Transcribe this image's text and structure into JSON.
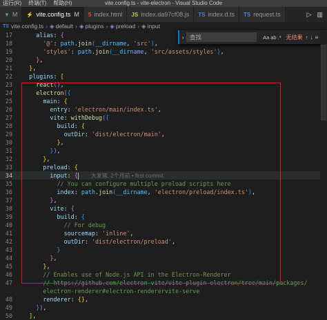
{
  "titlebar": {
    "menu": [
      "运行(R)",
      "终端(T)",
      "帮助(H)"
    ],
    "title": "vite.config.ts - vite-electron - Visual Studio Code"
  },
  "tabs": [
    {
      "icon": "vue",
      "label": "M",
      "modified": false,
      "active": false
    },
    {
      "icon": "vite",
      "label": "vite.config.ts",
      "mod": "M",
      "active": true
    },
    {
      "icon": "html",
      "label": "index.html",
      "active": false
    },
    {
      "icon": "js",
      "label": "index.da97cf08.js",
      "active": false
    },
    {
      "icon": "ts",
      "label": "index.d.ts",
      "active": false
    },
    {
      "icon": "ts",
      "label": "request.ts",
      "active": false
    }
  ],
  "breadcrumb": [
    "vite.config.ts",
    "default",
    "plugins",
    "preload",
    "input"
  ],
  "find": {
    "placeholder": "查找",
    "opt_case": "Aa",
    "opt_word": "ab",
    "opt_regex": ".*",
    "result": "无结果"
  },
  "code_lines": [
    {
      "n": "17",
      "tokens": [
        [
          "w",
          "      "
        ],
        [
          "p",
          "alias"
        ],
        [
          "w",
          ": "
        ],
        [
          "b2",
          "{"
        ]
      ]
    },
    {
      "n": "18",
      "tokens": [
        [
          "w",
          "        "
        ],
        [
          "s",
          "'@'"
        ],
        [
          "w",
          ": "
        ],
        [
          "v",
          "path"
        ],
        [
          "w",
          "."
        ],
        [
          "f",
          "join"
        ],
        [
          "b3",
          "("
        ],
        [
          "v",
          "__dirname"
        ],
        [
          "w",
          ", "
        ],
        [
          "s",
          "'src'"
        ],
        [
          "b3",
          ")"
        ],
        [
          "w",
          ","
        ]
      ]
    },
    {
      "n": "19",
      "tokens": [
        [
          "w",
          "        "
        ],
        [
          "s",
          "'styles'"
        ],
        [
          "w",
          ": "
        ],
        [
          "v",
          "path"
        ],
        [
          "w",
          "."
        ],
        [
          "f",
          "join"
        ],
        [
          "b3",
          "("
        ],
        [
          "v",
          "__dirname"
        ],
        [
          "w",
          ", "
        ],
        [
          "s",
          "'src/assets/styles'"
        ],
        [
          "b3",
          ")"
        ],
        [
          "w",
          ","
        ]
      ]
    },
    {
      "n": "20",
      "tokens": [
        [
          "w",
          "      "
        ],
        [
          "b2",
          "}"
        ],
        [
          "w",
          ","
        ]
      ]
    },
    {
      "n": "21",
      "tokens": [
        [
          "w",
          "    "
        ],
        [
          "b1",
          "}"
        ],
        [
          "w",
          ","
        ]
      ]
    },
    {
      "n": "22",
      "tokens": [
        [
          "w",
          "    "
        ],
        [
          "p",
          "plugins"
        ],
        [
          "w",
          ": "
        ],
        [
          "b1",
          "["
        ]
      ]
    },
    {
      "n": "23",
      "tokens": [
        [
          "w",
          "      "
        ],
        [
          "f",
          "react"
        ],
        [
          "b2",
          "()"
        ],
        [
          "w",
          ","
        ]
      ]
    },
    {
      "n": "24",
      "tokens": [
        [
          "w",
          "      "
        ],
        [
          "f",
          "electron"
        ],
        [
          "b2",
          "("
        ],
        [
          "b3",
          "{"
        ]
      ]
    },
    {
      "n": "25",
      "tokens": [
        [
          "w",
          "        "
        ],
        [
          "p",
          "main"
        ],
        [
          "w",
          ": "
        ],
        [
          "b1",
          "{"
        ]
      ]
    },
    {
      "n": "26",
      "tokens": [
        [
          "w",
          "          "
        ],
        [
          "p",
          "entry"
        ],
        [
          "w",
          ": "
        ],
        [
          "s",
          "'electron/main/index.ts'"
        ],
        [
          "w",
          ","
        ]
      ]
    },
    {
      "n": "27",
      "tokens": [
        [
          "w",
          "          "
        ],
        [
          "p",
          "vite"
        ],
        [
          "w",
          ": "
        ],
        [
          "f",
          "withDebug"
        ],
        [
          "b2",
          "("
        ],
        [
          "b3",
          "{"
        ]
      ]
    },
    {
      "n": "28",
      "tokens": [
        [
          "w",
          "            "
        ],
        [
          "p",
          "build"
        ],
        [
          "w",
          ": "
        ],
        [
          "b1",
          "{"
        ]
      ]
    },
    {
      "n": "29",
      "tokens": [
        [
          "w",
          "              "
        ],
        [
          "p",
          "outDir"
        ],
        [
          "w",
          ": "
        ],
        [
          "s",
          "'dist/electron/main'"
        ],
        [
          "w",
          ","
        ]
      ]
    },
    {
      "n": "30",
      "tokens": [
        [
          "w",
          "            "
        ],
        [
          "b1",
          "}"
        ],
        [
          "w",
          ","
        ]
      ]
    },
    {
      "n": "31",
      "tokens": [
        [
          "w",
          "          "
        ],
        [
          "b3",
          "}"
        ],
        [
          "b2",
          ")"
        ],
        [
          "w",
          ","
        ]
      ]
    },
    {
      "n": "32",
      "tokens": [
        [
          "w",
          "        "
        ],
        [
          "b1",
          "}"
        ],
        [
          "w",
          ","
        ]
      ]
    },
    {
      "n": "33",
      "tokens": [
        [
          "w",
          "        "
        ],
        [
          "p",
          "preload"
        ],
        [
          "w",
          ": "
        ],
        [
          "b1",
          "{"
        ]
      ]
    },
    {
      "n": "34",
      "tokens": [
        [
          "w",
          "          "
        ],
        [
          "p",
          "input"
        ],
        [
          "w",
          ": "
        ],
        [
          "b2",
          "{"
        ],
        [
          "cursor",
          ""
        ]
      ],
      "blame": "大发猪, 2个月前 • first commit",
      "current": true
    },
    {
      "n": "35",
      "tokens": [
        [
          "w",
          "            "
        ],
        [
          "c",
          "// You can configure multiple preload scripts here"
        ]
      ]
    },
    {
      "n": "36",
      "tokens": [
        [
          "w",
          "            "
        ],
        [
          "p",
          "index"
        ],
        [
          "w",
          ": "
        ],
        [
          "v",
          "path"
        ],
        [
          "w",
          "."
        ],
        [
          "f",
          "join"
        ],
        [
          "b3",
          "("
        ],
        [
          "v",
          "__dirname"
        ],
        [
          "w",
          ", "
        ],
        [
          "s",
          "'electron/preload/index.ts'"
        ],
        [
          "b3",
          ")"
        ],
        [
          "w",
          ","
        ]
      ]
    },
    {
      "n": "37",
      "tokens": [
        [
          "w",
          "          "
        ],
        [
          "b2",
          "}"
        ],
        [
          "w",
          ","
        ]
      ]
    },
    {
      "n": "38",
      "tokens": [
        [
          "w",
          "          "
        ],
        [
          "p",
          "vite"
        ],
        [
          "w",
          ": "
        ],
        [
          "b2",
          "{"
        ]
      ]
    },
    {
      "n": "39",
      "tokens": [
        [
          "w",
          "            "
        ],
        [
          "p",
          "build"
        ],
        [
          "w",
          ": "
        ],
        [
          "b3",
          "{"
        ]
      ]
    },
    {
      "n": "40",
      "tokens": [
        [
          "w",
          "              "
        ],
        [
          "c",
          "// For debug"
        ]
      ]
    },
    {
      "n": "41",
      "tokens": [
        [
          "w",
          "              "
        ],
        [
          "p",
          "sourcemap"
        ],
        [
          "w",
          ": "
        ],
        [
          "s",
          "'inline'"
        ],
        [
          "w",
          ","
        ]
      ]
    },
    {
      "n": "42",
      "tokens": [
        [
          "w",
          "              "
        ],
        [
          "p",
          "outDir"
        ],
        [
          "w",
          ": "
        ],
        [
          "s",
          "'dist/electron/preload'"
        ],
        [
          "w",
          ","
        ]
      ]
    },
    {
      "n": "43",
      "tokens": [
        [
          "w",
          "            "
        ],
        [
          "b3",
          "}"
        ]
      ]
    },
    {
      "n": "44",
      "tokens": [
        [
          "w",
          "          "
        ],
        [
          "b2",
          "}"
        ],
        [
          "w",
          ","
        ]
      ]
    },
    {
      "n": "45",
      "tokens": [
        [
          "w",
          "        "
        ],
        [
          "b1",
          "}"
        ],
        [
          "w",
          ","
        ]
      ]
    },
    {
      "n": "46",
      "tokens": [
        [
          "w",
          "        "
        ],
        [
          "c",
          "// Enables use of Node.js API in the Electron-Renderer"
        ]
      ]
    },
    {
      "n": "47",
      "tokens": [
        [
          "w",
          "        "
        ],
        [
          "c",
          "// https://github.com/electron-vite/vite-plugin-electron/tree/main/packages/"
        ]
      ]
    },
    {
      "n": "",
      "tokens": [
        [
          "w",
          "        "
        ],
        [
          "c",
          "electron-renderer#electron-renderervite-serve"
        ]
      ]
    },
    {
      "n": "48",
      "tokens": [
        [
          "w",
          "        "
        ],
        [
          "p",
          "renderer"
        ],
        [
          "w",
          ": "
        ],
        [
          "b1",
          "{}"
        ],
        [
          "w",
          ","
        ]
      ]
    },
    {
      "n": "49",
      "tokens": [
        [
          "w",
          "      "
        ],
        [
          "b3",
          "}"
        ],
        [
          "b2",
          ")"
        ],
        [
          "w",
          ","
        ]
      ]
    },
    {
      "n": "50",
      "tokens": [
        [
          "w",
          "    "
        ],
        [
          "b1",
          "]"
        ],
        [
          "w",
          ","
        ]
      ]
    }
  ]
}
